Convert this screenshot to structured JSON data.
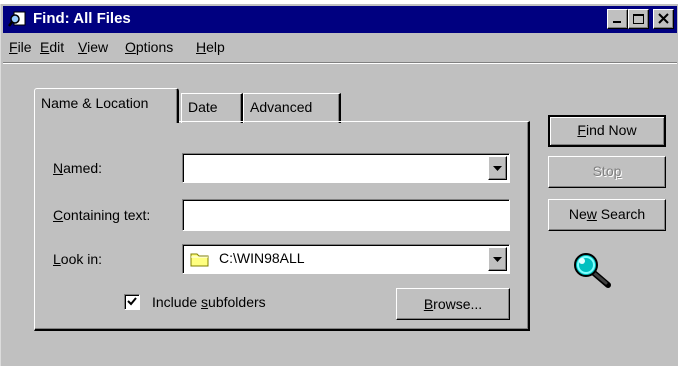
{
  "window": {
    "title": "Find: All Files"
  },
  "title_buttons": {
    "minimize": "_",
    "maximize": "□",
    "close": "×"
  },
  "menu": [
    {
      "label": "File",
      "mnemonic": "F"
    },
    {
      "label": "Edit",
      "mnemonic": "E"
    },
    {
      "label": "View",
      "mnemonic": "V"
    },
    {
      "label": "Options",
      "mnemonic": "O"
    },
    {
      "label": "Help",
      "mnemonic": "H"
    }
  ],
  "tabs": [
    {
      "label": "Name & Location",
      "active": true
    },
    {
      "label": "Date",
      "active": false
    },
    {
      "label": "Advanced",
      "active": false
    }
  ],
  "form": {
    "named": {
      "label_mnemonic": "N",
      "label_rest": "amed:",
      "value": ""
    },
    "containing": {
      "label_mnemonic": "C",
      "label_rest": "ontaining text:",
      "value": ""
    },
    "look_in": {
      "label_mnemonic": "L",
      "label_rest": "ook in:",
      "value": "C:\\WIN98ALL",
      "icon": "folder-icon"
    },
    "subfolders": {
      "label_pre": "Include ",
      "label_mnemonic": "s",
      "label_rest": "ubfolders",
      "checked": true
    },
    "browse": {
      "label_mnemonic": "B",
      "label_rest": "rowse..."
    }
  },
  "actions": {
    "find_now": {
      "label_mnemonic": "F",
      "label_rest": "ind Now"
    },
    "stop": {
      "label_pre": "Sto",
      "label_mnemonic": "p"
    },
    "new_search": {
      "label_pre": "Ne",
      "label_mnemonic": "w",
      "label_rest": " Search"
    }
  },
  "icons": {
    "title": "find-icon",
    "animation": "magnifier-icon"
  },
  "colors": {
    "titlebar": "#000080",
    "face": "#c0c0c0",
    "magnifier": "#00c0c0"
  }
}
